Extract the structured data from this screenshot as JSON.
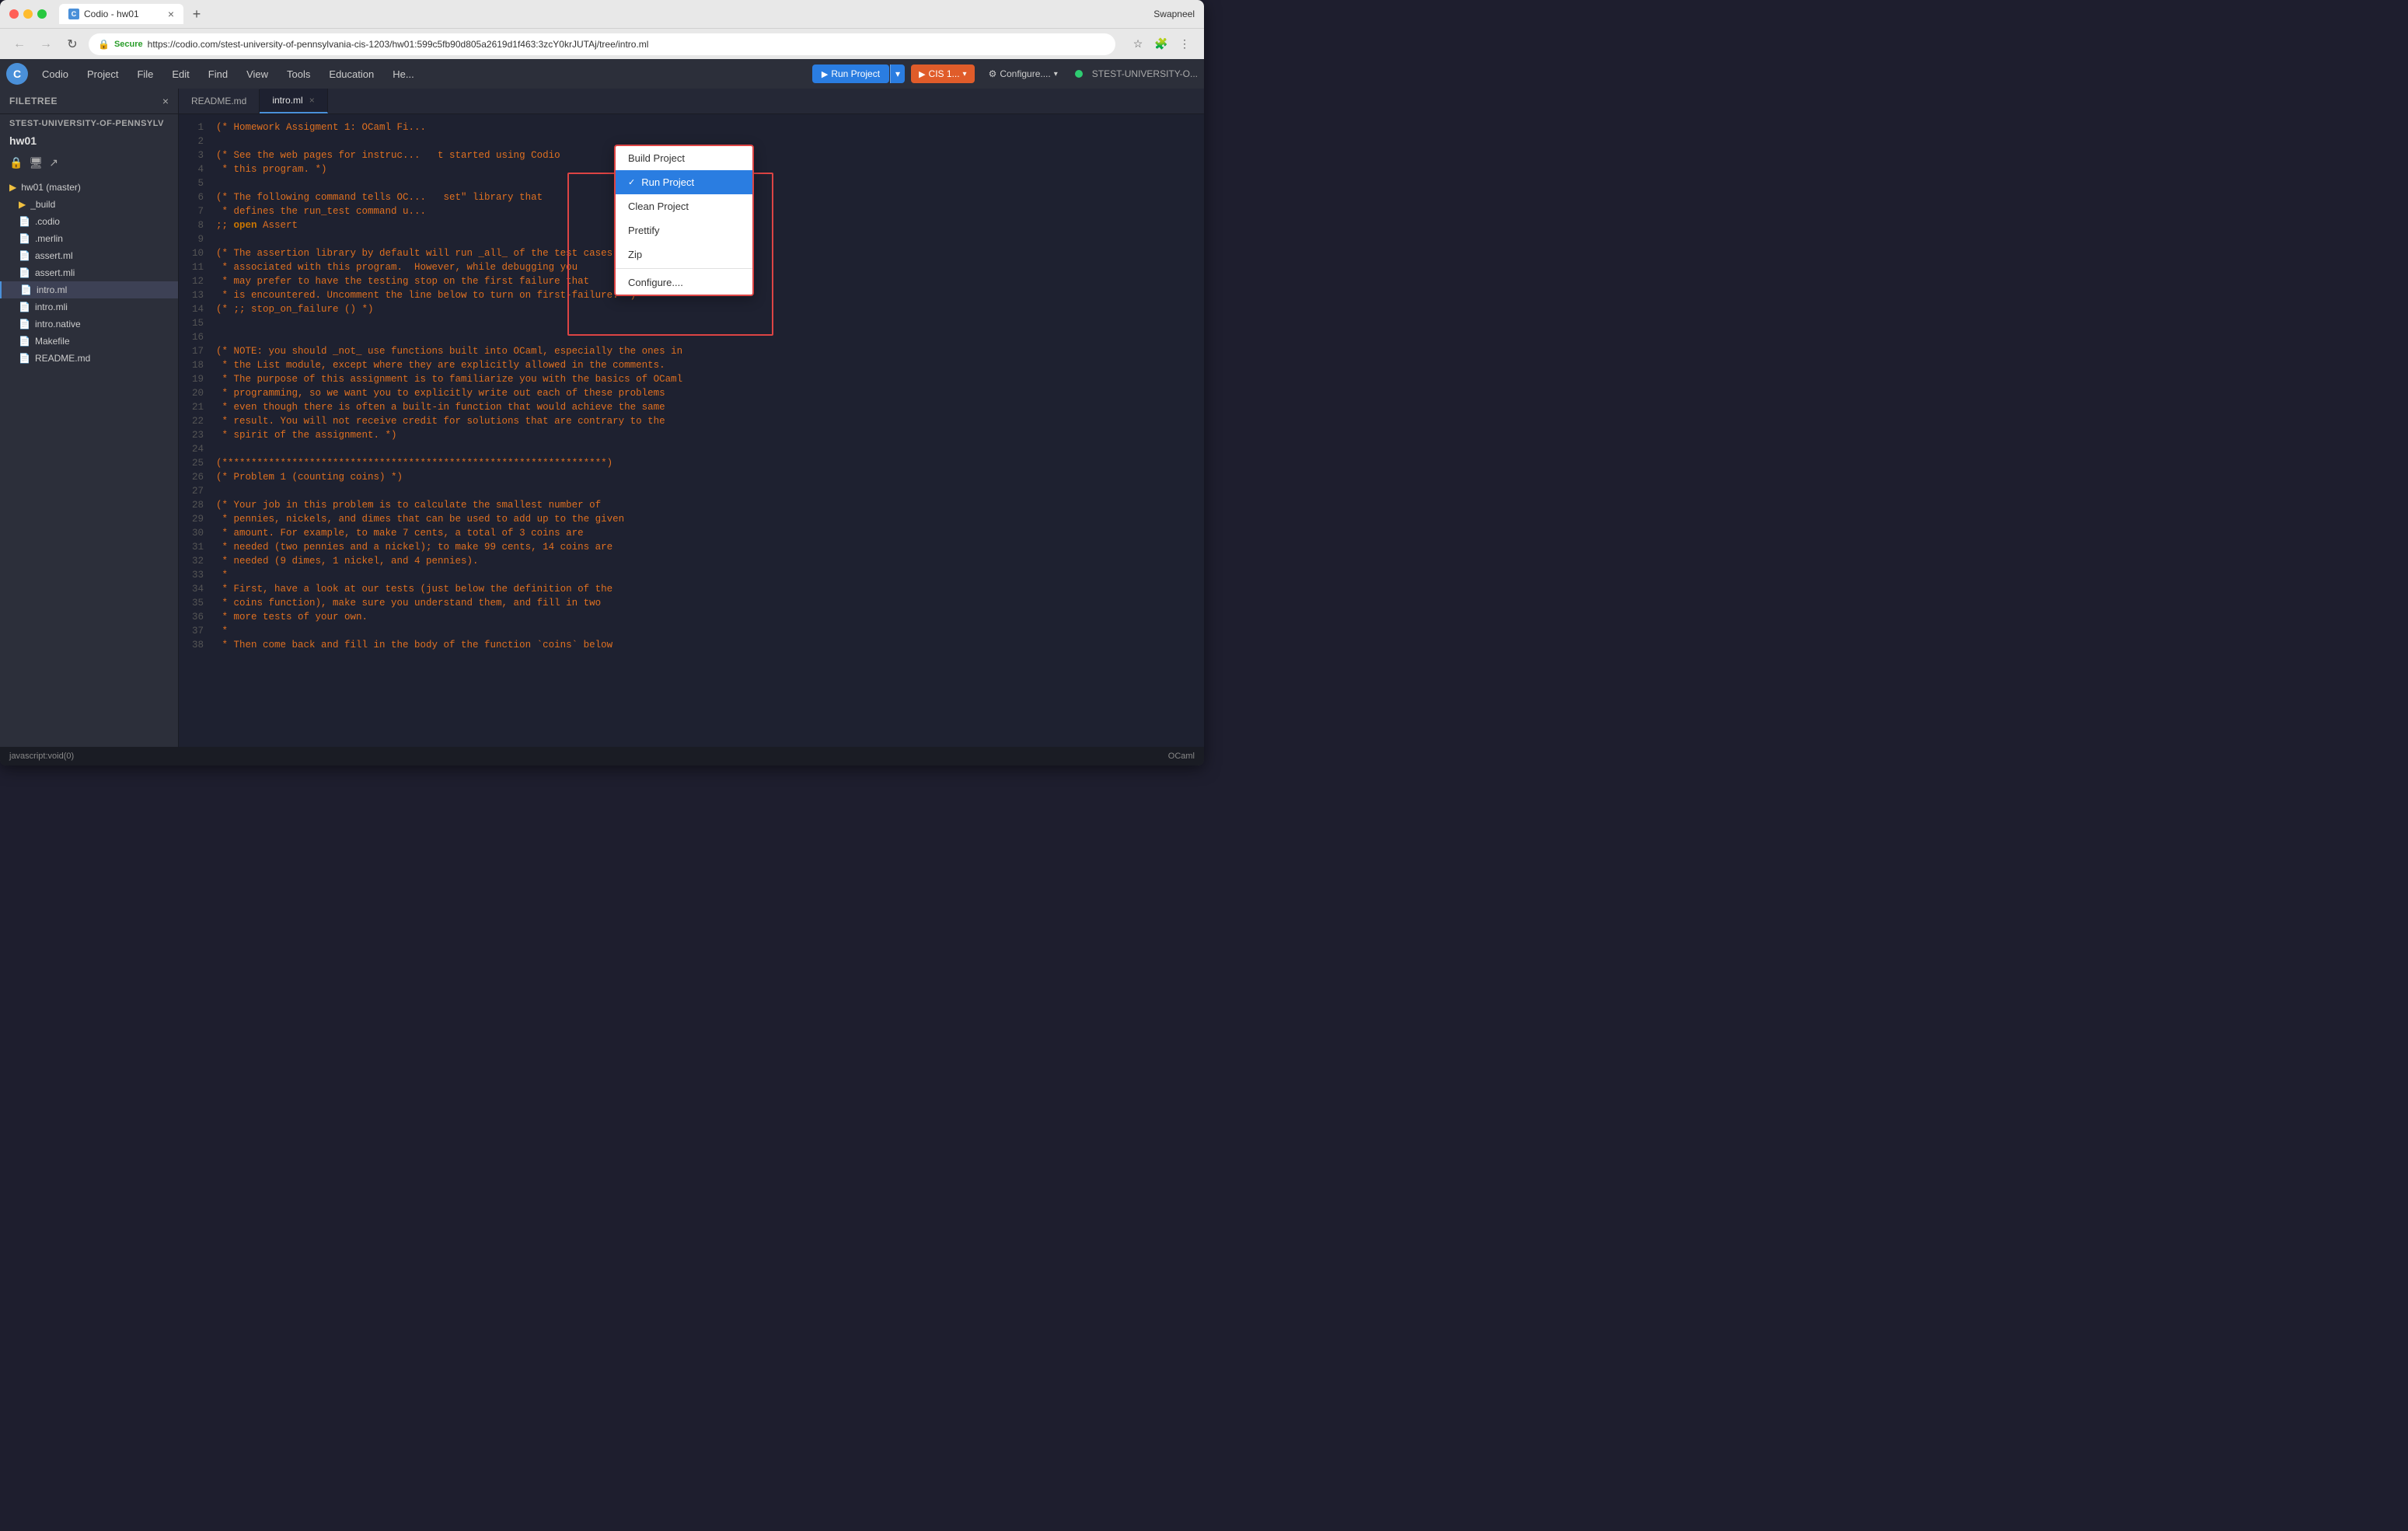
{
  "browser": {
    "title": "Codio - hw01",
    "user": "Swapneel",
    "url": "https://codio.com/stest-university-of-pennsylvania-cis-1203/hw01:599c5fb90d805a2619d1f463:3zcY0krJUTAj/tree/intro.ml",
    "secure_label": "Secure",
    "tab_label": "Codio - hw01",
    "new_tab_empty": ""
  },
  "app": {
    "logo": "C",
    "menu_items": [
      "Codio",
      "Project",
      "File",
      "Edit",
      "Find",
      "View",
      "Tools",
      "Education",
      "Help"
    ],
    "run_project_label": "Run Project",
    "cis_label": "CIS 1...",
    "configure_label": "Configure....",
    "project_name_label": "STEST-UNIVERSITY-O...",
    "status_indicator": "online"
  },
  "sidebar": {
    "title": "Filetree",
    "project_prefix": "STEST-UNIVERSITY-OF-PENNSYLV",
    "project_name": "hw01",
    "master_label": "hw01 (master)",
    "files": [
      {
        "name": "_build",
        "type": "folder",
        "indent": 1
      },
      {
        "name": ".codio",
        "type": "file",
        "indent": 2
      },
      {
        "name": ".merlin",
        "type": "file",
        "indent": 2
      },
      {
        "name": "assert.ml",
        "type": "file-ml",
        "indent": 2
      },
      {
        "name": "assert.mli",
        "type": "file-mli",
        "indent": 2
      },
      {
        "name": "intro.ml",
        "type": "file-ml",
        "indent": 2,
        "active": true
      },
      {
        "name": "intro.mli",
        "type": "file-mli",
        "indent": 2
      },
      {
        "name": "intro.native",
        "type": "file-native",
        "indent": 2
      },
      {
        "name": "Makefile",
        "type": "file-makefile",
        "indent": 2
      },
      {
        "name": "README.md",
        "type": "file-readme",
        "indent": 2
      }
    ]
  },
  "editor": {
    "tabs": [
      {
        "name": "README.md",
        "active": false,
        "closeable": false
      },
      {
        "name": "intro.ml",
        "active": true,
        "closeable": true
      }
    ],
    "lines": [
      {
        "num": 1,
        "text": "(* Homework Assigment 1: OCaml Fi..."
      },
      {
        "num": 2,
        "text": ""
      },
      {
        "num": 3,
        "text": "(* See the web pages for instruc...   t started using Codio"
      },
      {
        "num": 4,
        "text": " * this program. *)"
      },
      {
        "num": 5,
        "text": ""
      },
      {
        "num": 6,
        "text": "(* The following command tells OC...   set\" library that"
      },
      {
        "num": 7,
        "text": " * defines the run_test command u..."
      },
      {
        "num": 8,
        "text": ";; open Assert"
      },
      {
        "num": 9,
        "text": ""
      },
      {
        "num": 10,
        "text": "(* The assertion library by default will run _all_ of the test cases"
      },
      {
        "num": 11,
        "text": " * associated with this program.  However, while debugging you"
      },
      {
        "num": 12,
        "text": " * may prefer to have the testing stop on the first failure that"
      },
      {
        "num": 13,
        "text": " * is encountered. Uncomment the line below to turn on first-failure. *)"
      },
      {
        "num": 14,
        "text": "(* ;; stop_on_failure () *)"
      },
      {
        "num": 15,
        "text": ""
      },
      {
        "num": 16,
        "text": ""
      },
      {
        "num": 17,
        "text": "(* NOTE: you should _not_ use functions built into OCaml, especially the ones in"
      },
      {
        "num": 18,
        "text": " * the List module, except where they are explicitly allowed in the comments."
      },
      {
        "num": 19,
        "text": " * The purpose of this assignment is to familiarize you with the basics of OCaml"
      },
      {
        "num": 20,
        "text": " * programming, so we want you to explicitly write out each of these problems"
      },
      {
        "num": 21,
        "text": " * even though there is often a built-in function that would achieve the same"
      },
      {
        "num": 22,
        "text": " * result. You will not receive credit for solutions that are contrary to the"
      },
      {
        "num": 23,
        "text": " * spirit of the assignment. *)"
      },
      {
        "num": 24,
        "text": ""
      },
      {
        "num": 25,
        "text": "(******************************************************************)"
      },
      {
        "num": 26,
        "text": "(* Problem 1 (counting coins) *)"
      },
      {
        "num": 27,
        "text": ""
      },
      {
        "num": 28,
        "text": "(* Your job in this problem is to calculate the smallest number of"
      },
      {
        "num": 29,
        "text": " * pennies, nickels, and dimes that can be used to add up to the given"
      },
      {
        "num": 30,
        "text": " * amount. For example, to make 7 cents, a total of 3 coins are"
      },
      {
        "num": 31,
        "text": " * needed (two pennies and a nickel); to make 99 cents, 14 coins are"
      },
      {
        "num": 32,
        "text": " * needed (9 dimes, 1 nickel, and 4 pennies)."
      },
      {
        "num": 33,
        "text": " *"
      },
      {
        "num": 34,
        "text": " * First, have a look at our tests (just below the definition of the"
      },
      {
        "num": 35,
        "text": " * coins function), make sure you understand them, and fill in two"
      },
      {
        "num": 36,
        "text": " * more tests of your own."
      },
      {
        "num": 37,
        "text": " *"
      },
      {
        "num": 38,
        "text": " * Then come back and fill in the body of the function `coins` below"
      }
    ]
  },
  "dropdown": {
    "items": [
      {
        "label": "Build Project",
        "active": false,
        "checkmark": false
      },
      {
        "label": "Run Project",
        "active": true,
        "checkmark": true
      },
      {
        "label": "Clean Project",
        "active": false,
        "checkmark": false
      },
      {
        "label": "Prettify",
        "active": false,
        "checkmark": false
      },
      {
        "label": "Zip",
        "active": false,
        "checkmark": false
      },
      {
        "label": "Configure....",
        "active": false,
        "checkmark": false
      }
    ]
  },
  "statusbar": {
    "left": "javascript:void(0)",
    "right": "OCaml"
  }
}
